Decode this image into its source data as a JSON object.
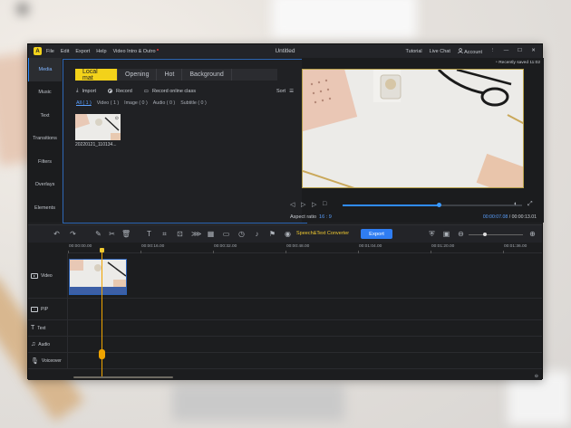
{
  "window": {
    "title": "Untitled",
    "logo_text": "A",
    "menu": [
      "File",
      "Edit",
      "Export",
      "Help",
      "Video Intro & Outro"
    ],
    "top_right": {
      "tutorial": "Tutorial",
      "live_chat": "Live Chat",
      "account": "Account"
    },
    "controls": [
      "—",
      "☐",
      "✕"
    ]
  },
  "rail": {
    "items": [
      {
        "label": "Media",
        "active": true
      },
      {
        "label": "Music"
      },
      {
        "label": "Text"
      },
      {
        "label": "Transitions"
      },
      {
        "label": "Filters"
      },
      {
        "label": "Overlays"
      },
      {
        "label": "Elements"
      }
    ]
  },
  "media": {
    "tabs": [
      "Local mat",
      "Opening",
      "Hot",
      "Background"
    ],
    "actions": {
      "import": "Import",
      "record": "Record",
      "record_online": "Record online class",
      "sort": "Sort"
    },
    "filters": [
      "All ( 1 )",
      "Video ( 1 )",
      "Image ( 0 )",
      "Audio ( 0 )",
      "Subtitle ( 0 )"
    ],
    "thumb_label": "20220121_110134..."
  },
  "preview": {
    "recently_saved": "Recently saved 11:02",
    "aspect_label": "Aspect ratio",
    "aspect_value": "16 : 9",
    "current_time": "00:00:07.08",
    "total_time": "/ 00:00:13.01",
    "progress": 0.54
  },
  "toolbar": {
    "speech": "Speech&Text Converter",
    "export": "Export"
  },
  "timeline": {
    "ticks": [
      "00:00:00.00",
      "00:00:16.00",
      "00:00:32.00",
      "00:00:48.00",
      "00:01:04.00",
      "00:01:20.00",
      "00:01:36.00"
    ],
    "tracks": [
      "Video",
      "PIP",
      "Text",
      "Audio",
      "Voiceover"
    ]
  },
  "colors": {
    "accent": "#f3d21a",
    "primary": "#2f7df2",
    "background": "#1f2022"
  }
}
